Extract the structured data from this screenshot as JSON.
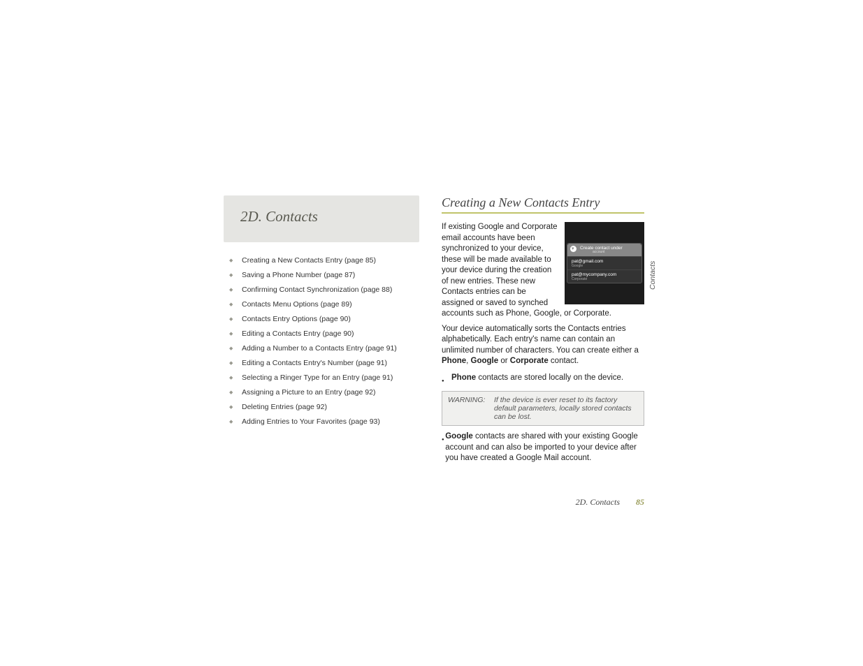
{
  "toc": {
    "chapter_title": "2D.  Contacts",
    "items": [
      "Creating a New Contacts Entry (page 85)",
      "Saving a Phone Number (page 87)",
      "Confirming Contact Synchronization (page 88)",
      "Contacts Menu Options (page 89)",
      "Contacts Entry Options (page 90)",
      "Editing a Contacts Entry (page 90)",
      "Adding a Number to a Contacts Entry (page 91)",
      "Editing a Contacts Entry's Number (page 91)",
      "Selecting a Ringer Type for an Entry (page 91)",
      "Assigning a Picture to an Entry (page 92)",
      "Deleting Entries (page 92)",
      "Adding Entries to Your Favorites (page 93)"
    ]
  },
  "section": {
    "heading": "Creating a New Contacts Entry",
    "intro_a": "If existing Google and Corporate email accounts have been synchronized to your device, these will be made available to your device during the creation of new entries. These new Contacts entries can be assigned or saved to synched accounts such as Phone, Google, or Corporate.",
    "para2_pre": "Your device automatically sorts the Contacts entries alphabetically. Each entry's name can contain an unlimited number of characters. You can create either a ",
    "para2_b1": "Phone",
    "para2_mid1": ", ",
    "para2_b2": "Google",
    "para2_mid2": " or ",
    "para2_b3": "Corporate",
    "para2_post": " contact.",
    "bullet1_b": "Phone",
    "bullet1_rest": " contacts are stored locally on the device.",
    "warning_label": "WARNING:",
    "warning_text": "If the device is ever reset to its factory default parameters, locally stored contacts can be lost.",
    "bullet2_b": "Google",
    "bullet2_rest": " contacts are shared with your existing Google account and can also be imported to your device after you have created a Google Mail account."
  },
  "screenshot": {
    "dialog_title": "Create contact under",
    "dialog_sub": "account",
    "acct1_mail": "pat@gmail.com",
    "acct1_src": "Google",
    "acct2_mail": "pat@mycompany.com",
    "acct2_src": "Corporate"
  },
  "tab": "Contacts",
  "footer": {
    "section": "2D. Contacts",
    "page": "85"
  }
}
